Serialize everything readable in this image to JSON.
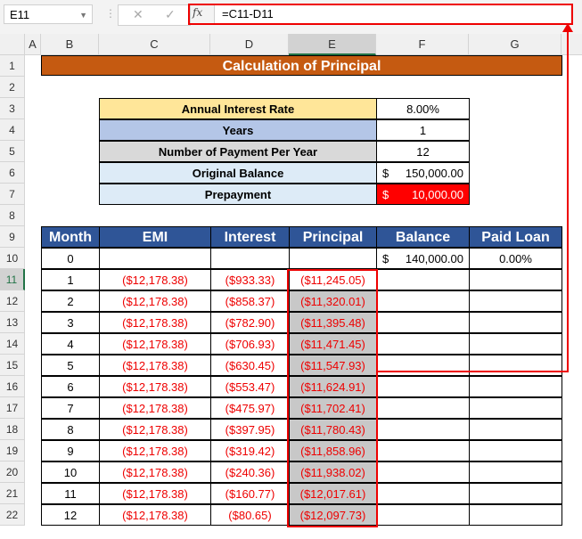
{
  "formula_bar": {
    "name_box": "E11",
    "formula": "=C11-D11",
    "fx_label": "fx",
    "cancel": "✕",
    "enter": "✓"
  },
  "columns": [
    "A",
    "B",
    "C",
    "D",
    "E",
    "F",
    "G"
  ],
  "rows": [
    "1",
    "2",
    "3",
    "4",
    "5",
    "6",
    "7",
    "8",
    "9",
    "10",
    "11",
    "12",
    "13",
    "14",
    "15",
    "16",
    "17",
    "18",
    "19",
    "20",
    "21",
    "22"
  ],
  "title": "Calculation of Principal",
  "inputs": [
    {
      "label": "Annual Interest Rate",
      "value": "8.00%",
      "color": "#ffe699"
    },
    {
      "label": "Years",
      "value": "1",
      "color": "#b4c6e7"
    },
    {
      "label": "Number of Payment Per Year",
      "value": "12",
      "color": "#d9d9d9"
    },
    {
      "label": "Original Balance",
      "currency": "$",
      "value": "150,000.00",
      "color": "#ddebf7"
    },
    {
      "label": "Prepayment",
      "currency": "$",
      "value": "10,000.00",
      "color": "#ddebf7",
      "value_bg": "#ff0000"
    }
  ],
  "table": {
    "headers": [
      "Month",
      "EMI",
      "Interest",
      "Principal",
      "Balance",
      "Paid Loan"
    ],
    "row0": {
      "month": "0",
      "currency": "$",
      "balance": "140,000.00",
      "paid": "0.00%"
    },
    "rows": [
      [
        "1",
        "($12,178.38)",
        "($933.33)",
        "($11,245.05)"
      ],
      [
        "2",
        "($12,178.38)",
        "($858.37)",
        "($11,320.01)"
      ],
      [
        "3",
        "($12,178.38)",
        "($782.90)",
        "($11,395.48)"
      ],
      [
        "4",
        "($12,178.38)",
        "($706.93)",
        "($11,471.45)"
      ],
      [
        "5",
        "($12,178.38)",
        "($630.45)",
        "($11,547.93)"
      ],
      [
        "6",
        "($12,178.38)",
        "($553.47)",
        "($11,624.91)"
      ],
      [
        "7",
        "($12,178.38)",
        "($475.97)",
        "($11,702.41)"
      ],
      [
        "8",
        "($12,178.38)",
        "($397.95)",
        "($11,780.43)"
      ],
      [
        "9",
        "($12,178.38)",
        "($319.42)",
        "($11,858.96)"
      ],
      [
        "10",
        "($12,178.38)",
        "($240.36)",
        "($11,938.02)"
      ],
      [
        "11",
        "($12,178.38)",
        "($160.77)",
        "($12,017.61)"
      ],
      [
        "12",
        "($12,178.38)",
        "($80.65)",
        "($12,097.73)"
      ]
    ]
  },
  "colors": {
    "title_bg": "#c55a11",
    "header_bg": "#2f5597",
    "negative": "#ff0000",
    "highlight": "#ff0000"
  }
}
